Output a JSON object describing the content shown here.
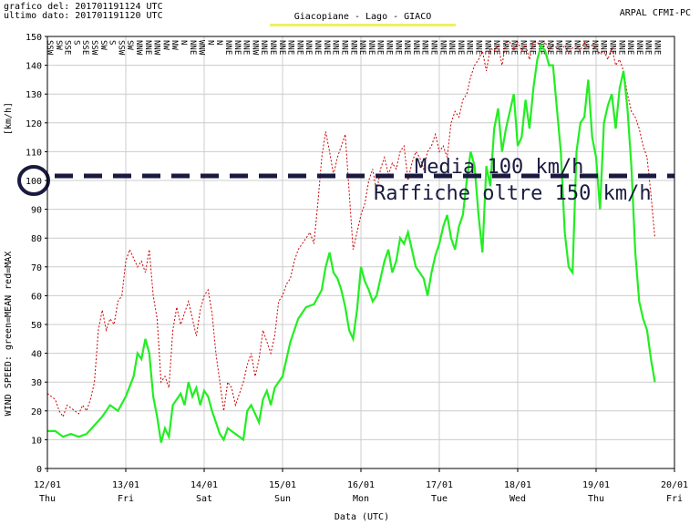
{
  "header": {
    "graph_date": "grafico del: 201701191124 UTC",
    "last_data": "ultimo dato: 201701191120 UTC",
    "station": "Giacopiane - Lago - GIACO",
    "agency": "ARPAL CFMI-PC"
  },
  "colors": {
    "mean": "#22ee22",
    "max": "#cc0000",
    "grid": "#cccccc",
    "station_underline": "#f0f060",
    "annotation": "#1a1a40"
  },
  "chart_data": {
    "type": "line",
    "title": "Giacopiane - Lago - GIACO",
    "xlabel": "Data (UTC)",
    "ylabel": "WIND SPEED: green=MEAN  red=MAX",
    "unit": "[km/h]",
    "ylim": [
      0,
      150
    ],
    "xlim": [
      0,
      8
    ],
    "grid": true,
    "y_ticks": [
      0,
      10,
      20,
      30,
      40,
      50,
      60,
      70,
      80,
      90,
      100,
      110,
      120,
      130,
      140,
      150
    ],
    "x_ticks": [
      {
        "date": "12/01",
        "day": "Thu"
      },
      {
        "date": "13/01",
        "day": "Fri"
      },
      {
        "date": "14/01",
        "day": "Sat"
      },
      {
        "date": "15/01",
        "day": "Sun"
      },
      {
        "date": "16/01",
        "day": "Mon"
      },
      {
        "date": "17/01",
        "day": "Tue"
      },
      {
        "date": "18/01",
        "day": "Wed"
      },
      {
        "date": "19/01",
        "day": "Thu"
      },
      {
        "date": "20/01",
        "day": "Fri"
      }
    ],
    "series": [
      {
        "name": "MEAN",
        "color": "green",
        "points": [
          [
            0,
            13
          ],
          [
            0.1,
            13
          ],
          [
            0.2,
            11
          ],
          [
            0.3,
            12
          ],
          [
            0.4,
            11
          ],
          [
            0.5,
            12
          ],
          [
            0.6,
            15
          ],
          [
            0.7,
            18
          ],
          [
            0.8,
            22
          ],
          [
            0.9,
            20
          ],
          [
            1.0,
            25
          ],
          [
            1.1,
            32
          ],
          [
            1.15,
            40
          ],
          [
            1.2,
            38
          ],
          [
            1.25,
            45
          ],
          [
            1.3,
            40
          ],
          [
            1.35,
            25
          ],
          [
            1.4,
            18
          ],
          [
            1.45,
            9
          ],
          [
            1.5,
            14
          ],
          [
            1.55,
            11
          ],
          [
            1.6,
            22
          ],
          [
            1.7,
            26
          ],
          [
            1.75,
            22
          ],
          [
            1.8,
            30
          ],
          [
            1.85,
            25
          ],
          [
            1.9,
            28
          ],
          [
            1.95,
            22
          ],
          [
            2.0,
            27
          ],
          [
            2.05,
            25
          ],
          [
            2.1,
            20
          ],
          [
            2.15,
            16
          ],
          [
            2.2,
            12
          ],
          [
            2.25,
            10
          ],
          [
            2.3,
            14
          ],
          [
            2.4,
            12
          ],
          [
            2.5,
            10
          ],
          [
            2.55,
            20
          ],
          [
            2.6,
            22
          ],
          [
            2.7,
            16
          ],
          [
            2.75,
            24
          ],
          [
            2.8,
            27
          ],
          [
            2.85,
            22
          ],
          [
            2.9,
            28
          ],
          [
            3.0,
            32
          ],
          [
            3.1,
            44
          ],
          [
            3.2,
            52
          ],
          [
            3.3,
            56
          ],
          [
            3.4,
            57
          ],
          [
            3.5,
            62
          ],
          [
            3.55,
            70
          ],
          [
            3.6,
            75
          ],
          [
            3.65,
            68
          ],
          [
            3.7,
            66
          ],
          [
            3.75,
            62
          ],
          [
            3.8,
            56
          ],
          [
            3.85,
            48
          ],
          [
            3.9,
            45
          ],
          [
            3.95,
            55
          ],
          [
            4.0,
            70
          ],
          [
            4.05,
            65
          ],
          [
            4.1,
            62
          ],
          [
            4.15,
            58
          ],
          [
            4.2,
            60
          ],
          [
            4.25,
            66
          ],
          [
            4.3,
            72
          ],
          [
            4.35,
            76
          ],
          [
            4.4,
            68
          ],
          [
            4.45,
            72
          ],
          [
            4.5,
            80
          ],
          [
            4.55,
            78
          ],
          [
            4.6,
            82
          ],
          [
            4.65,
            76
          ],
          [
            4.7,
            70
          ],
          [
            4.75,
            68
          ],
          [
            4.8,
            66
          ],
          [
            4.85,
            60
          ],
          [
            4.9,
            68
          ],
          [
            4.95,
            74
          ],
          [
            5.0,
            78
          ],
          [
            5.05,
            84
          ],
          [
            5.1,
            88
          ],
          [
            5.15,
            80
          ],
          [
            5.2,
            76
          ],
          [
            5.25,
            84
          ],
          [
            5.3,
            88
          ],
          [
            5.35,
            100
          ],
          [
            5.4,
            110
          ],
          [
            5.45,
            105
          ],
          [
            5.5,
            88
          ],
          [
            5.55,
            75
          ],
          [
            5.6,
            105
          ],
          [
            5.65,
            98
          ],
          [
            5.7,
            118
          ],
          [
            5.75,
            125
          ],
          [
            5.8,
            110
          ],
          [
            5.85,
            118
          ],
          [
            5.9,
            124
          ],
          [
            5.95,
            130
          ],
          [
            6.0,
            112
          ],
          [
            6.05,
            115
          ],
          [
            6.1,
            128
          ],
          [
            6.15,
            118
          ],
          [
            6.2,
            132
          ],
          [
            6.25,
            142
          ],
          [
            6.3,
            147
          ],
          [
            6.35,
            145
          ],
          [
            6.4,
            140
          ],
          [
            6.45,
            140
          ],
          [
            6.5,
            125
          ],
          [
            6.55,
            110
          ],
          [
            6.6,
            82
          ],
          [
            6.65,
            70
          ],
          [
            6.7,
            68
          ],
          [
            6.75,
            110
          ],
          [
            6.8,
            120
          ],
          [
            6.85,
            122
          ],
          [
            6.9,
            135
          ],
          [
            6.95,
            115
          ],
          [
            7.0,
            108
          ],
          [
            7.05,
            90
          ],
          [
            7.1,
            120
          ],
          [
            7.15,
            126
          ],
          [
            7.2,
            130
          ],
          [
            7.25,
            118
          ],
          [
            7.3,
            132
          ],
          [
            7.35,
            138
          ],
          [
            7.4,
            125
          ],
          [
            7.45,
            105
          ],
          [
            7.5,
            75
          ],
          [
            7.55,
            58
          ],
          [
            7.6,
            52
          ],
          [
            7.65,
            48
          ],
          [
            7.7,
            38
          ],
          [
            7.75,
            30
          ]
        ]
      },
      {
        "name": "MAX",
        "color": "red",
        "points": [
          [
            0,
            26
          ],
          [
            0.1,
            24
          ],
          [
            0.15,
            20
          ],
          [
            0.2,
            18
          ],
          [
            0.25,
            22
          ],
          [
            0.3,
            21
          ],
          [
            0.35,
            20
          ],
          [
            0.4,
            19
          ],
          [
            0.45,
            22
          ],
          [
            0.5,
            20
          ],
          [
            0.55,
            24
          ],
          [
            0.6,
            30
          ],
          [
            0.65,
            48
          ],
          [
            0.7,
            55
          ],
          [
            0.75,
            48
          ],
          [
            0.8,
            52
          ],
          [
            0.85,
            50
          ],
          [
            0.9,
            58
          ],
          [
            0.95,
            60
          ],
          [
            1.0,
            72
          ],
          [
            1.05,
            76
          ],
          [
            1.1,
            73
          ],
          [
            1.15,
            70
          ],
          [
            1.2,
            72
          ],
          [
            1.25,
            68
          ],
          [
            1.3,
            76
          ],
          [
            1.35,
            60
          ],
          [
            1.4,
            52
          ],
          [
            1.45,
            30
          ],
          [
            1.5,
            32
          ],
          [
            1.55,
            28
          ],
          [
            1.6,
            48
          ],
          [
            1.65,
            56
          ],
          [
            1.7,
            50
          ],
          [
            1.75,
            54
          ],
          [
            1.8,
            58
          ],
          [
            1.85,
            52
          ],
          [
            1.9,
            46
          ],
          [
            1.95,
            55
          ],
          [
            2.0,
            60
          ],
          [
            2.05,
            62
          ],
          [
            2.1,
            54
          ],
          [
            2.15,
            40
          ],
          [
            2.2,
            30
          ],
          [
            2.25,
            20
          ],
          [
            2.3,
            30
          ],
          [
            2.35,
            28
          ],
          [
            2.4,
            22
          ],
          [
            2.45,
            26
          ],
          [
            2.5,
            30
          ],
          [
            2.55,
            36
          ],
          [
            2.6,
            40
          ],
          [
            2.65,
            32
          ],
          [
            2.7,
            38
          ],
          [
            2.75,
            48
          ],
          [
            2.8,
            44
          ],
          [
            2.85,
            40
          ],
          [
            2.9,
            46
          ],
          [
            2.95,
            58
          ],
          [
            3.0,
            60
          ],
          [
            3.05,
            64
          ],
          [
            3.1,
            66
          ],
          [
            3.15,
            72
          ],
          [
            3.2,
            76
          ],
          [
            3.25,
            78
          ],
          [
            3.3,
            80
          ],
          [
            3.35,
            82
          ],
          [
            3.4,
            78
          ],
          [
            3.45,
            92
          ],
          [
            3.5,
            108
          ],
          [
            3.55,
            117
          ],
          [
            3.6,
            110
          ],
          [
            3.65,
            102
          ],
          [
            3.7,
            108
          ],
          [
            3.75,
            112
          ],
          [
            3.8,
            116
          ],
          [
            3.85,
            96
          ],
          [
            3.9,
            76
          ],
          [
            3.95,
            82
          ],
          [
            4.0,
            88
          ],
          [
            4.05,
            92
          ],
          [
            4.1,
            100
          ],
          [
            4.15,
            104
          ],
          [
            4.2,
            96
          ],
          [
            4.25,
            104
          ],
          [
            4.3,
            108
          ],
          [
            4.35,
            102
          ],
          [
            4.4,
            106
          ],
          [
            4.45,
            104
          ],
          [
            4.5,
            110
          ],
          [
            4.55,
            112
          ],
          [
            4.6,
            100
          ],
          [
            4.65,
            106
          ],
          [
            4.7,
            110
          ],
          [
            4.75,
            108
          ],
          [
            4.8,
            104
          ],
          [
            4.85,
            110
          ],
          [
            4.9,
            112
          ],
          [
            4.95,
            116
          ],
          [
            5.0,
            110
          ],
          [
            5.05,
            112
          ],
          [
            5.1,
            108
          ],
          [
            5.15,
            120
          ],
          [
            5.2,
            124
          ],
          [
            5.25,
            122
          ],
          [
            5.3,
            128
          ],
          [
            5.35,
            130
          ],
          [
            5.4,
            136
          ],
          [
            5.45,
            140
          ],
          [
            5.5,
            142
          ],
          [
            5.55,
            145
          ],
          [
            5.6,
            138
          ],
          [
            5.65,
            146
          ],
          [
            5.7,
            145
          ],
          [
            5.75,
            147
          ],
          [
            5.8,
            140
          ],
          [
            5.85,
            148
          ],
          [
            5.9,
            148
          ],
          [
            5.95,
            145
          ],
          [
            6.0,
            148
          ],
          [
            6.05,
            145
          ],
          [
            6.1,
            147
          ],
          [
            6.15,
            142
          ],
          [
            6.2,
            148
          ],
          [
            6.25,
            148
          ],
          [
            6.3,
            146
          ],
          [
            6.35,
            148
          ],
          [
            6.4,
            145
          ],
          [
            6.45,
            147
          ],
          [
            6.5,
            146
          ],
          [
            6.55,
            145
          ],
          [
            6.6,
            147
          ],
          [
            6.65,
            144
          ],
          [
            6.7,
            146
          ],
          [
            6.75,
            147
          ],
          [
            6.8,
            145
          ],
          [
            6.85,
            148
          ],
          [
            6.9,
            146
          ],
          [
            6.95,
            147
          ],
          [
            7.0,
            146
          ],
          [
            7.05,
            144
          ],
          [
            7.1,
            145
          ],
          [
            7.15,
            142
          ],
          [
            7.2,
            146
          ],
          [
            7.25,
            140
          ],
          [
            7.3,
            142
          ],
          [
            7.35,
            138
          ],
          [
            7.4,
            130
          ],
          [
            7.45,
            124
          ],
          [
            7.5,
            122
          ],
          [
            7.55,
            118
          ],
          [
            7.6,
            112
          ],
          [
            7.65,
            108
          ],
          [
            7.7,
            95
          ],
          [
            7.75,
            80
          ]
        ]
      }
    ],
    "direction_labels": [
      "SSW",
      "SW",
      "SSE",
      "S",
      "SSE",
      "SSW",
      "SW",
      "S",
      "SSW",
      "SW",
      "NNW",
      "NNE",
      "NNW",
      "NW",
      "NW",
      "N",
      "NNE",
      "WNW",
      "N",
      "N",
      "NNE",
      "NNE",
      "NNE",
      "NNW",
      "NNE",
      "NNE",
      "NNE",
      "NNE",
      "NNE",
      "NNE",
      "NNE",
      "NNE",
      "NNE",
      "NNE",
      "NNE",
      "NNE",
      "NNE",
      "NNE",
      "NNE",
      "NNE",
      "NNE",
      "NNE",
      "NNE",
      "NNE",
      "NNE",
      "NNE",
      "NNE",
      "NNE",
      "NNE",
      "NNE",
      "NNE",
      "NNE",
      "NNE",
      "NNE",
      "NNE",
      "NNE",
      "NNE",
      "NNE",
      "NNE",
      "NNE",
      "NNE",
      "NNE",
      "NNE",
      "NNE",
      "NNE",
      "NNE",
      "NNE",
      "NNE",
      "NNE"
    ],
    "annotations": {
      "threshold_value": 100,
      "line1": "Media 100 km/h",
      "line2": "Raffiche oltre 150 km/h"
    }
  }
}
